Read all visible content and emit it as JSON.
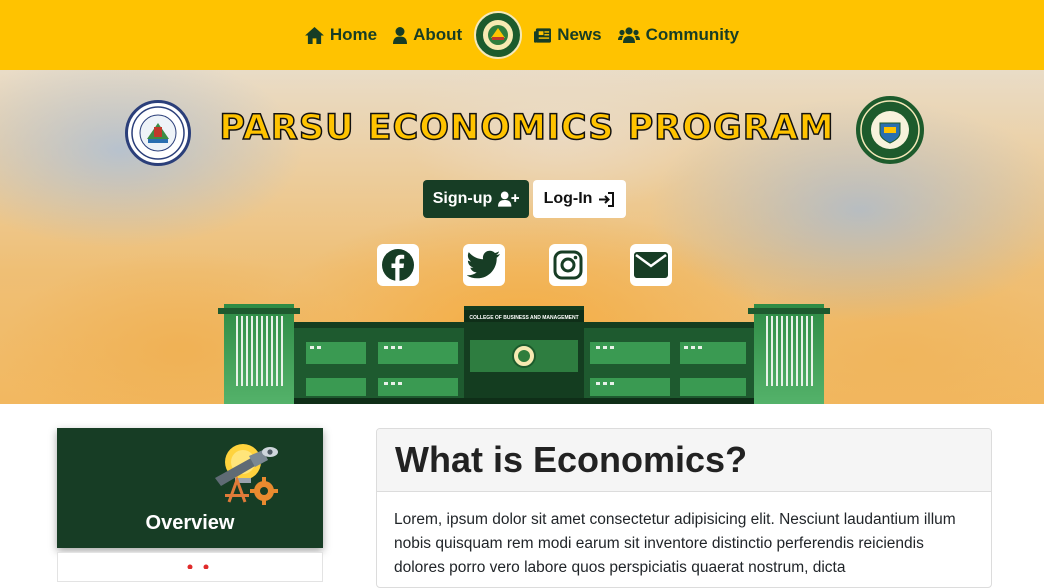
{
  "nav": {
    "items": [
      {
        "label": "Home",
        "icon": "home-icon"
      },
      {
        "label": "About",
        "icon": "user-icon"
      },
      {
        "label": "News",
        "icon": "newspaper-icon"
      },
      {
        "label": "Community",
        "icon": "users-icon"
      }
    ],
    "logo_icon": "department-seal-logo"
  },
  "hero": {
    "title": "PARSU ECONOMICS PROGRAM",
    "signup_label": "Sign-up",
    "login_label": "Log-In",
    "social_icons": [
      "facebook-icon",
      "twitter-icon",
      "instagram-icon",
      "envelope-icon"
    ],
    "building_sign": "COLLEGE OF BUSINESS AND MANAGEMENT"
  },
  "sidebar": {
    "overview_label": "Overview"
  },
  "main": {
    "heading": "What is Economics?",
    "body": "Lorem, ipsum dolor sit amet consectetur adipisicing elit. Nesciunt laudantium illum nobis quisquam rem modi earum sit inventore distinctio perferendis reiciendis dolores porro vero labore quos perspiciatis quaerat nostrum, dicta"
  },
  "colors": {
    "nav_bg": "#ffc300",
    "brand_green": "#173d25",
    "title_yellow": "#ffc300"
  }
}
